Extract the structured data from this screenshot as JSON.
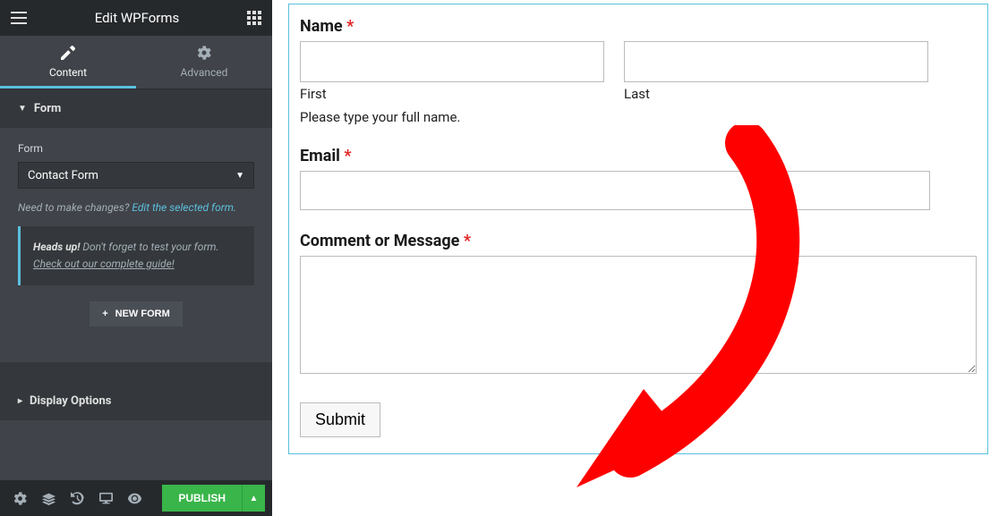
{
  "header": {
    "title": "Edit WPForms"
  },
  "tabs": {
    "content": "Content",
    "advanced": "Advanced"
  },
  "form_section": {
    "title": "Form",
    "label": "Form",
    "selected": "Contact Form",
    "helper_prefix": "Need to make changes? ",
    "helper_link": "Edit the selected form.",
    "notice_strong": "Heads up!",
    "notice_text": " Don't forget to test your form. ",
    "notice_link": "Check out our complete guide!",
    "new_form": "NEW FORM"
  },
  "display_section": {
    "title": "Display Options"
  },
  "footer": {
    "publish": "PUBLISH"
  },
  "preview": {
    "name_label": "Name",
    "first": "First",
    "last": "Last",
    "name_desc": "Please type your full name.",
    "email_label": "Email",
    "comment_label": "Comment or Message",
    "submit": "Submit"
  }
}
